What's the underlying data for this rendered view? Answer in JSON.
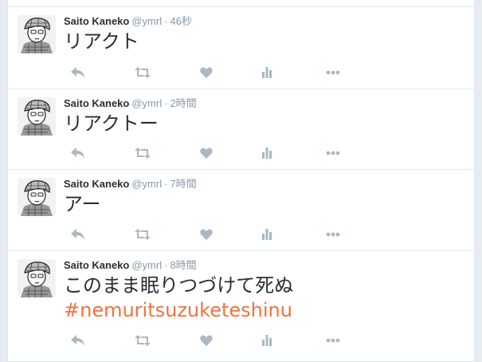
{
  "tweets": [
    {
      "name": "Saito Kaneko",
      "handle": "@ymrl",
      "separator": "·",
      "time": "46秒",
      "text": "リアクト",
      "hashtag": ""
    },
    {
      "name": "Saito Kaneko",
      "handle": "@ymrl",
      "separator": "·",
      "time": "2時間",
      "text": "リアクトー",
      "hashtag": ""
    },
    {
      "name": "Saito Kaneko",
      "handle": "@ymrl",
      "separator": "·",
      "time": "7時間",
      "text": "アー",
      "hashtag": ""
    },
    {
      "name": "Saito Kaneko",
      "handle": "@ymrl",
      "separator": "·",
      "time": "8時間",
      "text": "このまま眠りつづけて死ぬ",
      "hashtag": "#nemuritsuzuketeshinu"
    }
  ],
  "icons": {
    "reply": "reply-icon",
    "retweet": "retweet-icon",
    "like": "heart-icon",
    "analytics": "analytics-icon",
    "more": "more-icon"
  },
  "colors": {
    "hashtag": "#f0743b",
    "action_icon": "#aab8c2",
    "name": "#292f33",
    "meta": "#8899a6"
  }
}
